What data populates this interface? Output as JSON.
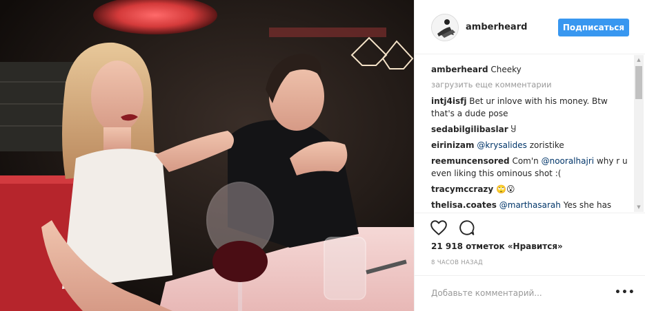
{
  "post": {
    "username": "amberheard",
    "follow_label": "Подписаться",
    "caption": {
      "username": "amberheard",
      "text": "Cheeky"
    },
    "load_more": "загрузить еще комментарии",
    "comments": [
      {
        "username": "intj4isfj",
        "text": "Bet ur inlove with his money. Btw that's a dude pose"
      },
      {
        "username": "sedabilgilibaslar",
        "text": "Ⴘ"
      },
      {
        "username": "eirinizam",
        "mention": "@krysalides",
        "text": "zoristike"
      },
      {
        "username": "reemuncensored",
        "pre": "Com'n",
        "mention": "@nooralhajri",
        "text": "why r u even liking this ominous shot :("
      },
      {
        "username": "tracymccrazy",
        "text": "🙄😮"
      },
      {
        "username": "thelisa.coates",
        "mention": "@marthasarah",
        "text": "Yes she has"
      }
    ],
    "likes": "21 918 отметок «Нравится»",
    "time": "8 ЧАСОВ НАЗАД",
    "add_comment_placeholder": "Добавьте комментарий...",
    "more_label": "•••"
  },
  "icons": {
    "like": "heart-outline-icon",
    "comment": "speech-bubble-icon",
    "more": "ellipsis-icon"
  },
  "colors": {
    "accent": "#3897f0",
    "mention": "#003569",
    "muted": "#999999",
    "border": "#efefef"
  }
}
